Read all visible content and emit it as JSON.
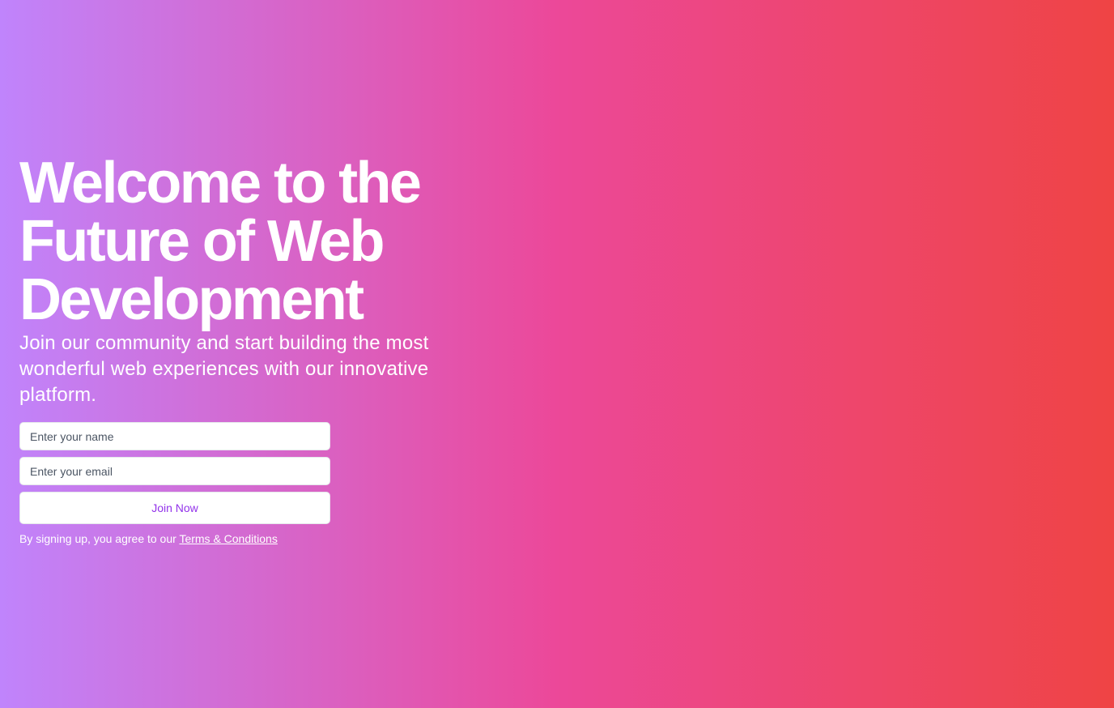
{
  "hero": {
    "headline": "Welcome to the Future of Web Development",
    "subheadline": "Join our community and start building the most wonderful web experiences with our innovative platform."
  },
  "form": {
    "name_placeholder": "Enter your name",
    "email_placeholder": "Enter your email",
    "submit_label": "Join Now"
  },
  "terms": {
    "prefix": "By signing up, you agree to our ",
    "link_label": "Terms & Conditions"
  },
  "colors": {
    "gradient_start": "#c084fc",
    "gradient_mid": "#ec4899",
    "gradient_end": "#ef4444",
    "button_text": "#9333ea"
  }
}
